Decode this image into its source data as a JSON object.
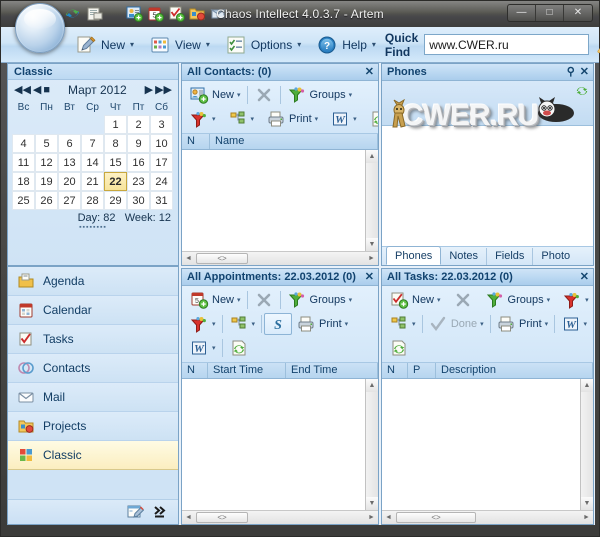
{
  "window": {
    "title": "Chaos Intellect 4.0.3.7 - Artem",
    "controls": {
      "minimize": "—",
      "maximize": "□",
      "close": "✕"
    },
    "title_icons": [
      "sync-icon",
      "print-preview-icon",
      "new-contact-icon",
      "new-appointment-icon",
      "new-task-icon",
      "new-project-icon",
      "new-mail-icon"
    ]
  },
  "toolbar": {
    "new_label": "New",
    "view_label": "View",
    "options_label": "Options",
    "help_label": "Help",
    "quickfind_label": "Quick Find",
    "quickfind_value": "www.CWER.ru",
    "caret": "▾"
  },
  "sidebar": {
    "header": "Classic",
    "calendar": {
      "month": "Март 2012",
      "nav": {
        "first": "◀◀",
        "prev": "◀",
        "today": "■",
        "next": "▶",
        "last": "▶▶"
      },
      "dow": [
        "Вс",
        "Пн",
        "Вт",
        "Ср",
        "Чт",
        "Пт",
        "Сб"
      ],
      "weeks": [
        [
          "",
          "",
          "",
          "",
          "1",
          "2",
          "3"
        ],
        [
          "4",
          "5",
          "6",
          "7",
          "8",
          "9",
          "10"
        ],
        [
          "11",
          "12",
          "13",
          "14",
          "15",
          "16",
          "17"
        ],
        [
          "18",
          "19",
          "20",
          "21",
          "22",
          "23",
          "24"
        ],
        [
          "25",
          "26",
          "27",
          "28",
          "29",
          "30",
          "31"
        ]
      ],
      "selected_day": "22",
      "day_label": "Day:",
      "day_value": "82",
      "week_label": "Week:",
      "week_value": "12"
    },
    "items": [
      {
        "label": "Agenda",
        "icon": "agenda-icon"
      },
      {
        "label": "Calendar",
        "icon": "calendar-icon"
      },
      {
        "label": "Tasks",
        "icon": "tasks-icon"
      },
      {
        "label": "Contacts",
        "icon": "contacts-icon"
      },
      {
        "label": "Mail",
        "icon": "mail-icon"
      },
      {
        "label": "Projects",
        "icon": "projects-icon"
      },
      {
        "label": "Classic",
        "icon": "classic-icon"
      }
    ],
    "active_item": "Classic",
    "footer_icons": [
      "edit-layout-icon",
      "expand-more-icon"
    ]
  },
  "contacts_panel": {
    "title": "All Contacts:  (0)",
    "close": "✕",
    "toolbar": {
      "new": "New",
      "delete_icon": "delete-x-icon",
      "groups": "Groups",
      "filter_icon": "filter-icon",
      "hierarchy_icon": "hierarchy-icon",
      "print": "Print",
      "word_icon": "word-export-icon",
      "refresh_icon": "refresh-icon",
      "caret": "▾"
    },
    "columns": [
      "N",
      "Name"
    ],
    "rows": []
  },
  "phones_panel": {
    "title": "Phones",
    "pin": "pin-icon",
    "close": "✕",
    "watermark": "CWER.RU",
    "refresh_icon": "refresh-icon",
    "tabs": [
      "Phones",
      "Notes",
      "Fields",
      "Photo"
    ],
    "active_tab": "Phones"
  },
  "appointments_panel": {
    "title": "All Appointments: 22.03.2012  (0)",
    "close": "✕",
    "toolbar": {
      "new": "New",
      "delete_icon": "delete-x-icon",
      "groups": "Groups",
      "filter_icon": "filter-icon",
      "hierarchy_icon": "hierarchy-icon",
      "sync_s_icon": "sync-s-icon",
      "print": "Print",
      "word_icon": "word-export-icon",
      "refresh_icon": "refresh-icon",
      "caret": "▾"
    },
    "columns": [
      "N",
      "Start Time",
      "End Time"
    ],
    "rows": []
  },
  "tasks_panel": {
    "title": "All Tasks: 22.03.2012  (0)",
    "close": "✕",
    "toolbar": {
      "new": "New",
      "delete_icon": "delete-x-icon",
      "groups": "Groups",
      "filter_icon": "filter-icon",
      "hierarchy_icon": "hierarchy-icon",
      "done": "Done",
      "print": "Print",
      "word_icon": "word-export-icon",
      "refresh_icon": "refresh-icon",
      "caret": "▾"
    },
    "columns": [
      "N",
      "P",
      "Description"
    ],
    "rows": []
  },
  "scroll": {
    "left_arrow": "◄",
    "right_arrow": "►",
    "up_arrow": "▲",
    "down_arrow": "▼",
    "thumb": "<>"
  },
  "colors": {
    "accent": "#12436f",
    "panel_header": "#bcd9f2",
    "selection": "#f7e49b",
    "frame": "#4a4a48"
  }
}
